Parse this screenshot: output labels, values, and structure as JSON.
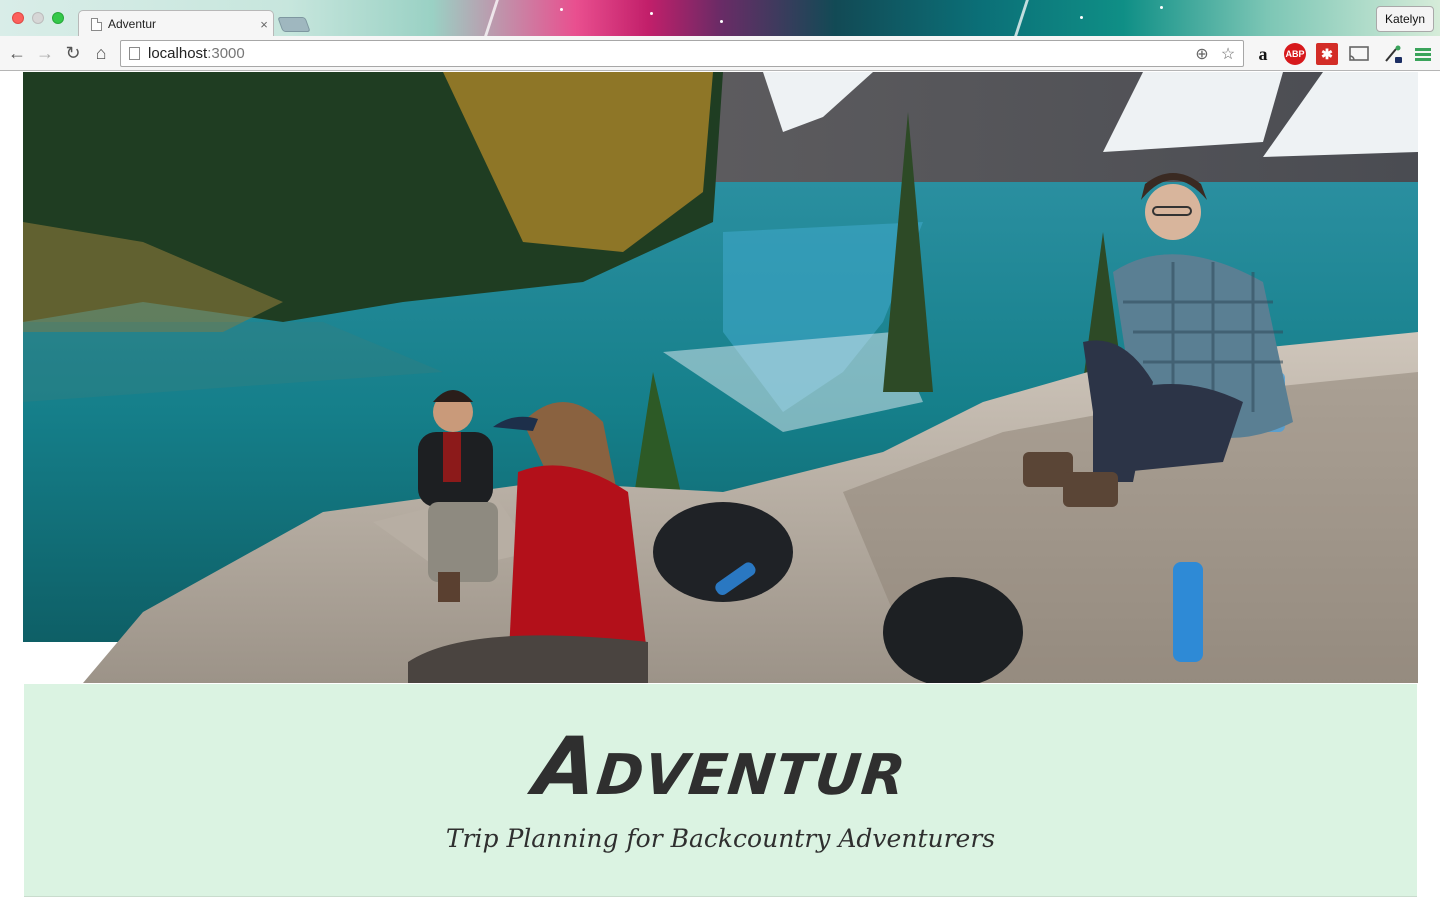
{
  "browser": {
    "tab_title": "Adventur",
    "tab_close": "×",
    "profile_name": "Katelyn",
    "url_host": "localhost",
    "url_port": ":3000",
    "icons": {
      "back": "←",
      "forward": "→",
      "reload": "↻",
      "home": "⌂",
      "zoom": "⊕",
      "bookmark": "☆",
      "amazon": "a",
      "adblock": "ABP",
      "lastpass": "✱",
      "cast": "▭",
      "dropper": "✎",
      "menu": "≡"
    }
  },
  "hero": {
    "colors": {
      "lake": "#1b8a93",
      "sky_snow": "#e8eef2",
      "rock": "#b9b1a7",
      "forest": "#1f3d22",
      "red_jacket": "#b3101a",
      "plaid_shirt": "#5a7f93"
    }
  },
  "banner": {
    "title": "Adventur",
    "tagline": "Trip Planning for Backcountry Adventurers",
    "background": "#dbf3e2",
    "text_color": "#2f2f2f"
  }
}
